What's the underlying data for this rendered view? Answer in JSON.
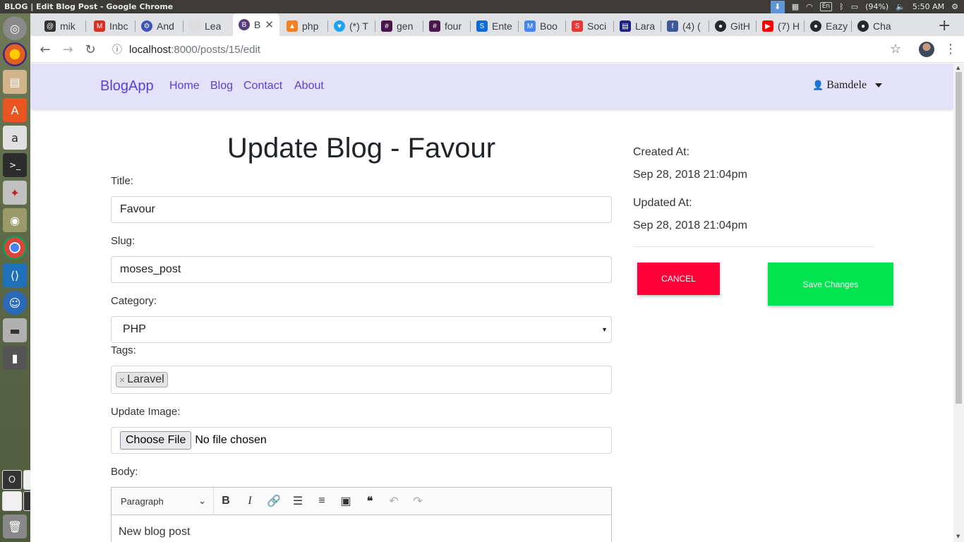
{
  "os": {
    "window_title": "BLOG | Edit Blog Post - Google Chrome",
    "keyboard_layout": "En",
    "battery": "(94%)",
    "clock": "5:50 AM"
  },
  "launcher": {
    "workspaces": [
      "O",
      "",
      "",
      "B"
    ]
  },
  "browser": {
    "tabs": [
      {
        "label": "mik",
        "icon": "mail-icon",
        "color": "#333333"
      },
      {
        "label": "Inbc",
        "icon": "gmail-icon",
        "color": "#d93025"
      },
      {
        "label": "And",
        "icon": "angular-icon",
        "color": "#3f51b5"
      },
      {
        "label": "Lea",
        "icon": "page-icon",
        "color": "#bbbbbb"
      },
      {
        "label": "B",
        "icon": "bootstrap-icon",
        "color": "#563d7c"
      },
      {
        "label": "php",
        "icon": "stackoverflow-icon",
        "color": "#f48024"
      },
      {
        "label": "(*) T",
        "icon": "twitter-icon",
        "color": "#1da1f2"
      },
      {
        "label": "gen",
        "icon": "slack-icon",
        "color": "#4a154b"
      },
      {
        "label": "four",
        "icon": "slack-icon",
        "color": "#4a154b"
      },
      {
        "label": "Ente",
        "icon": "sap-icon",
        "color": "#0a6ed1"
      },
      {
        "label": "Boo",
        "icon": "mdb-icon",
        "color": "#4285f4"
      },
      {
        "label": "Soci",
        "icon": "socialite-icon",
        "color": "#e53935"
      },
      {
        "label": "Lara",
        "icon": "doc-icon",
        "color": "#1a237e"
      },
      {
        "label": "(4) (",
        "icon": "facebook-icon",
        "color": "#3b5998"
      },
      {
        "label": "GitH",
        "icon": "github-icon",
        "color": "#24292e"
      },
      {
        "label": "(7) H",
        "icon": "youtube-icon",
        "color": "#ff0000"
      },
      {
        "label": "Eazy",
        "icon": "github-icon",
        "color": "#24292e"
      },
      {
        "label": "Cha",
        "icon": "github-icon",
        "color": "#24292e"
      }
    ],
    "new_tab": "+",
    "url_host": "localhost",
    "url_path": ":8000/posts/15/edit"
  },
  "nav": {
    "brand": "BlogApp",
    "links": [
      "Home",
      "Blog",
      "Contact",
      "About"
    ],
    "user": "Bamdele"
  },
  "page": {
    "title": "Update Blog - Favour"
  },
  "form": {
    "title_label": "Title:",
    "title_value": "Favour",
    "slug_label": "Slug:",
    "slug_value": "moses_post",
    "category_label": "Category:",
    "category_value": "PHP",
    "tags_label": "Tags:",
    "tag_remove": "×",
    "tags": [
      "Laravel"
    ],
    "image_label": "Update Image:",
    "file_button": "Choose File",
    "file_status": "No file chosen",
    "body_label": "Body:",
    "editor_format": "Paragraph",
    "editor_content": "New blog post"
  },
  "meta": {
    "created_label": "Created At:",
    "created_value": "Sep 28, 2018 21:04pm",
    "updated_label": "Updated At:",
    "updated_value": "Sep 28, 2018 21:04pm"
  },
  "actions": {
    "cancel": "CANCEL",
    "save": "Save Changes",
    "cancel_color": "#ff0039",
    "save_color": "#00e54e"
  }
}
